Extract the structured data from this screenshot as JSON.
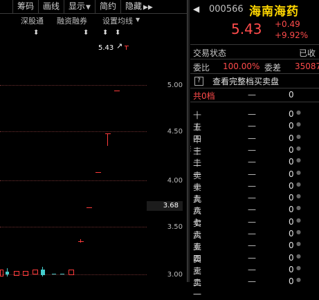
{
  "toolbar": {
    "items": [
      "筹码",
      "画线",
      "显示",
      "简约",
      "隐藏"
    ],
    "more_icon": "double-chevron-right-icon"
  },
  "chart": {
    "sub_options": [
      "深股通",
      "融资融券",
      "设置均线"
    ],
    "last_price_label": "5.43",
    "current_price_tag": "3.68",
    "axis": [
      "5.00",
      "4.50",
      "4.00",
      "3.50",
      "3.00"
    ]
  },
  "quote": {
    "code": "000566",
    "name": "海南海药",
    "price": "5.43",
    "change": "+0.49",
    "change_pct": "+9.92%",
    "status_label": "交易状态",
    "status_value": "已收",
    "weibi_label": "委比",
    "weibi_value": "100.00%",
    "weicha_label": "委差",
    "weicha_value": "35087",
    "full_book_button": "查看完整档买卖盘",
    "help_icon": "?",
    "total_label": "共0档",
    "total_dash": "—",
    "total_zero": "0"
  },
  "order_book": {
    "rows": [
      {
        "label": "十五",
        "dash": "—",
        "qty": "0"
      },
      {
        "label": "十四",
        "dash": "—",
        "qty": "0"
      },
      {
        "label": "十三",
        "dash": "—",
        "qty": "0"
      },
      {
        "label": "十二",
        "dash": "—",
        "qty": "0"
      },
      {
        "label": "十一",
        "dash": "—",
        "qty": "0"
      },
      {
        "label": "卖十",
        "dash": "—",
        "qty": "0"
      },
      {
        "label": "卖九",
        "dash": "—",
        "qty": "0"
      },
      {
        "label": "卖八",
        "dash": "—",
        "qty": "0"
      },
      {
        "label": "卖七",
        "dash": "—",
        "qty": "0"
      },
      {
        "label": "卖六",
        "dash": "—",
        "qty": "0"
      },
      {
        "label": "卖五",
        "dash": "—",
        "qty": "0"
      },
      {
        "label": "卖四",
        "dash": "—",
        "qty": "0"
      },
      {
        "label": "卖三",
        "dash": "—",
        "qty": "0"
      },
      {
        "label": "卖二",
        "dash": "—",
        "qty": "0"
      },
      {
        "label": "卖一",
        "dash": "—",
        "qty": "0"
      }
    ]
  }
}
